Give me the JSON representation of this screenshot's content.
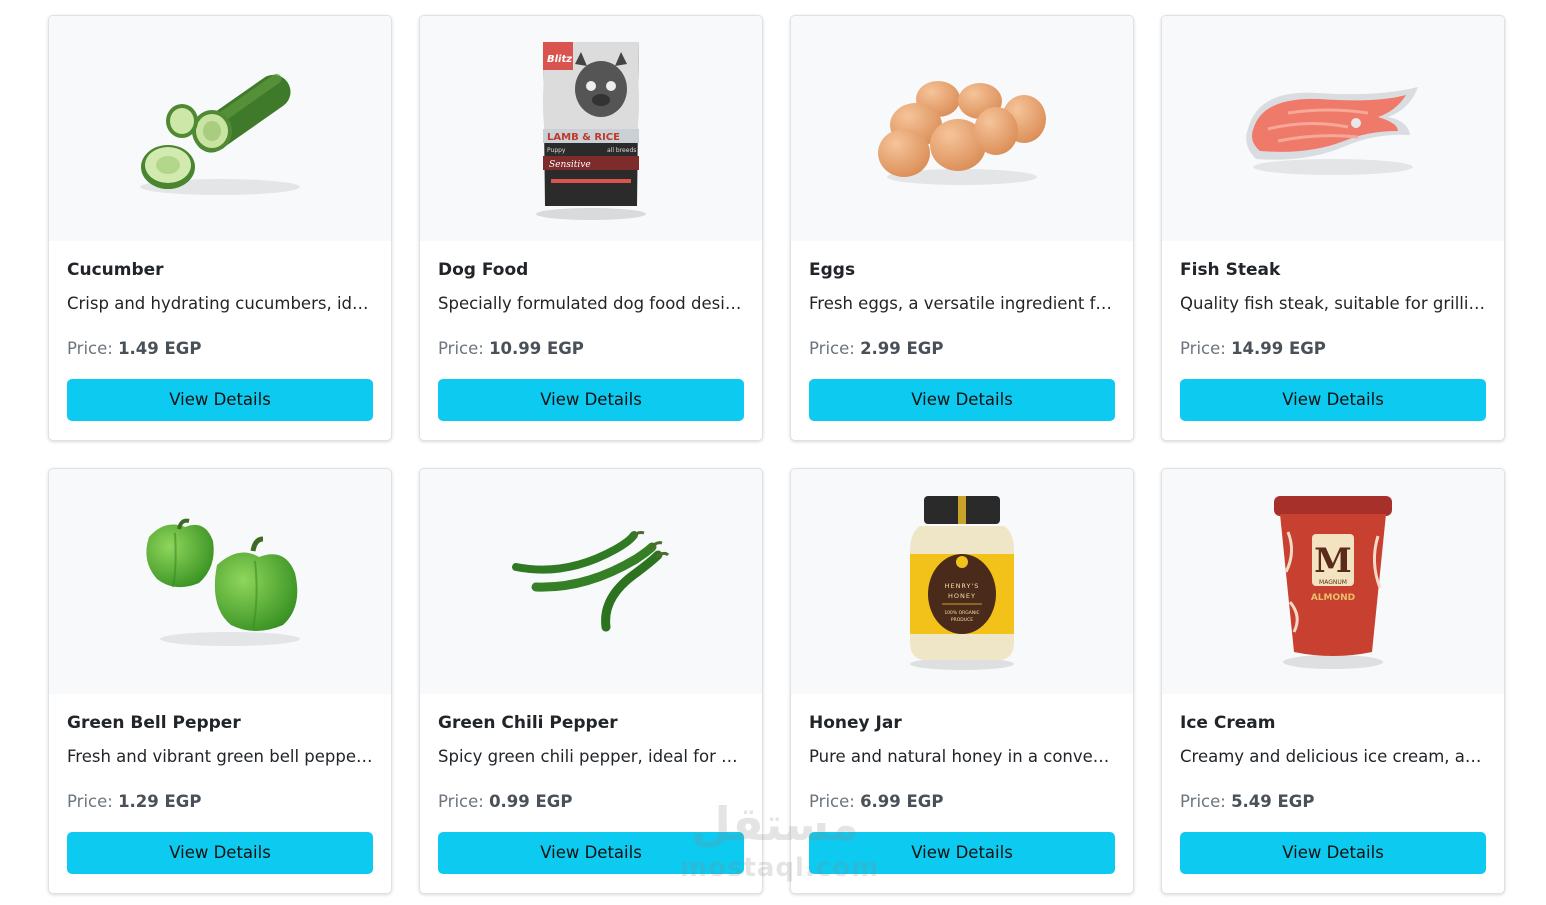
{
  "product_grid": {
    "price_label": "Price:",
    "currency": "EGP",
    "button_label": "View Details",
    "accent_color": "#0dcaf0",
    "products": [
      {
        "name": "Cucumber",
        "description": "Crisp and hydrating cucumbers, ideal for salads and snacks",
        "price": "1.49 EGP",
        "image": "cucumber-image"
      },
      {
        "name": "Dog Food",
        "description": "Specially formulated dog food designed to keep your pet healthy",
        "price": "10.99 EGP",
        "image": "dog-food-image"
      },
      {
        "name": "Eggs",
        "description": "Fresh eggs, a versatile ingredient for baking and cooking",
        "price": "2.99 EGP",
        "image": "eggs-image"
      },
      {
        "name": "Fish Steak",
        "description": "Quality fish steak, suitable for grilling or baking",
        "price": "14.99 EGP",
        "image": "fish-steak-image"
      },
      {
        "name": "Green Bell Pepper",
        "description": "Fresh and vibrant green bell pepper, perfect for cooking",
        "price": "1.29 EGP",
        "image": "green-bell-pepper-image"
      },
      {
        "name": "Green Chili Pepper",
        "description": "Spicy green chili pepper, ideal for adding heat to dishes",
        "price": "0.99 EGP",
        "image": "green-chili-pepper-image"
      },
      {
        "name": "Honey Jar",
        "description": "Pure and natural honey in a convenient jar",
        "price": "6.99 EGP",
        "image": "honey-jar-image"
      },
      {
        "name": "Ice Cream",
        "description": "Creamy and delicious ice cream, available in various flavors",
        "price": "5.49 EGP",
        "image": "ice-cream-image"
      }
    ]
  },
  "images": {
    "dog_food": {
      "brand": "Blitz",
      "line1": "LAMB & RICE",
      "line2": "Puppy",
      "line3": "all breeds",
      "line4": "Sensitive"
    },
    "honey_jar": {
      "line1": "HENRY'S",
      "line2": "HONEY",
      "line3": "100% ORGANIC",
      "line4": "PRODUCE"
    },
    "ice_cream": {
      "letter": "M",
      "brand": "MAGNUM",
      "flavor": "ALMOND"
    }
  },
  "watermark": {
    "arabic": "مستقل",
    "latin": "mostaql.com"
  }
}
